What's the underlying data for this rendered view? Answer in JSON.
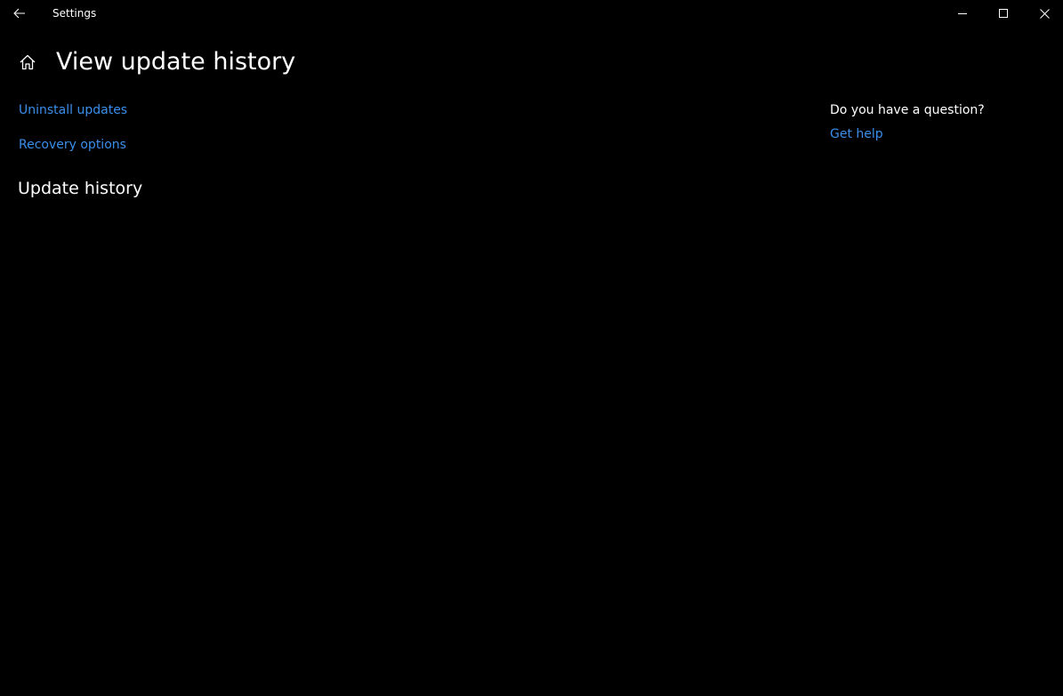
{
  "window": {
    "title": "Settings",
    "controls": {
      "minimize": "minimize-icon",
      "maximize": "maximize-icon",
      "close": "close-icon"
    }
  },
  "header": {
    "home_icon": "home-icon",
    "title": "View update history"
  },
  "main": {
    "links": {
      "uninstall": "Uninstall updates",
      "recovery": "Recovery options"
    },
    "section_title": "Update history"
  },
  "side_panel": {
    "question": "Do you have a question?",
    "help_link": "Get help"
  },
  "colors": {
    "background": "#000000",
    "text": "#ffffff",
    "link": "#3b8eea"
  }
}
